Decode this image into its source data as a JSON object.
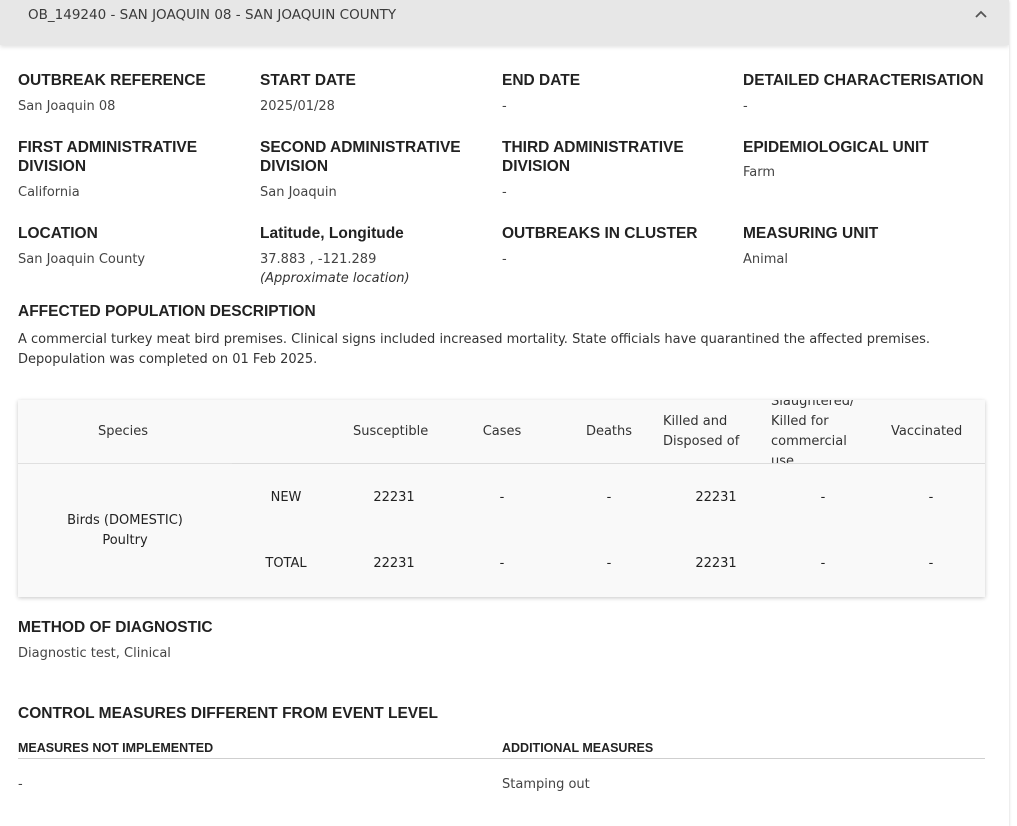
{
  "header": {
    "title": "OB_149240 - SAN JOAQUIN 08 - SAN JOAQUIN COUNTY",
    "toggle_icon": "chevron-up-icon"
  },
  "details": {
    "outbreak_reference": {
      "label": "OUTBREAK REFERENCE",
      "value": "San Joaquin 08"
    },
    "start_date": {
      "label": "START DATE",
      "value": "2025/01/28"
    },
    "end_date": {
      "label": "END DATE",
      "value": "-"
    },
    "detailed_characterisation": {
      "label": "DETAILED CHARACTERISATION",
      "value": "-"
    },
    "first_admin_division": {
      "label": "FIRST ADMINISTRATIVE DIVISION",
      "value": "California"
    },
    "second_admin_division": {
      "label": "SECOND ADMINISTRATIVE DIVISION",
      "value": "San Joaquin"
    },
    "third_admin_division": {
      "label": "THIRD ADMINISTRATIVE DIVISION",
      "value": "-"
    },
    "epidemiological_unit": {
      "label": "EPIDEMIOLOGICAL UNIT",
      "value": "Farm"
    },
    "location": {
      "label": "LOCATION",
      "value": "San Joaquin County"
    },
    "lat_long": {
      "label": "Latitude, Longitude",
      "value": "37.883 , -121.289",
      "note": "(Approximate location)"
    },
    "outbreaks_in_cluster": {
      "label": "OUTBREAKS IN CLUSTER",
      "value": "-"
    },
    "measuring_unit": {
      "label": "MEASURING UNIT",
      "value": "Animal"
    }
  },
  "affected_population": {
    "label": "AFFECTED POPULATION DESCRIPTION",
    "text": "A commercial turkey meat bird premises. Clinical signs included increased mortality. State officials have quarantined the affected premises. Depopulation was completed on 01 Feb 2025."
  },
  "population_table": {
    "headers": {
      "species": "Species",
      "susceptible": "Susceptible",
      "cases": "Cases",
      "deaths": "Deaths",
      "killed": "Killed and Disposed of",
      "slaughtered": "Slaughtered/ Killed for commercial use",
      "vaccinated": "Vaccinated"
    },
    "species_name": "Birds (DOMESTIC) Poultry",
    "rows": [
      {
        "type": "NEW",
        "susceptible": "22231",
        "cases": "-",
        "deaths": "-",
        "killed": "22231",
        "slaughtered": "-",
        "vaccinated": "-"
      },
      {
        "type": "TOTAL",
        "susceptible": "22231",
        "cases": "-",
        "deaths": "-",
        "killed": "22231",
        "slaughtered": "-",
        "vaccinated": "-"
      }
    ]
  },
  "diagnostic": {
    "label": "METHOD OF DIAGNOSTIC",
    "value": "Diagnostic test, Clinical"
  },
  "control_measures": {
    "label": "CONTROL MEASURES DIFFERENT FROM EVENT LEVEL",
    "not_implemented": {
      "label": "MEASURES NOT IMPLEMENTED",
      "value": "-"
    },
    "additional": {
      "label": "ADDITIONAL MEASURES",
      "value": "Stamping out"
    }
  }
}
